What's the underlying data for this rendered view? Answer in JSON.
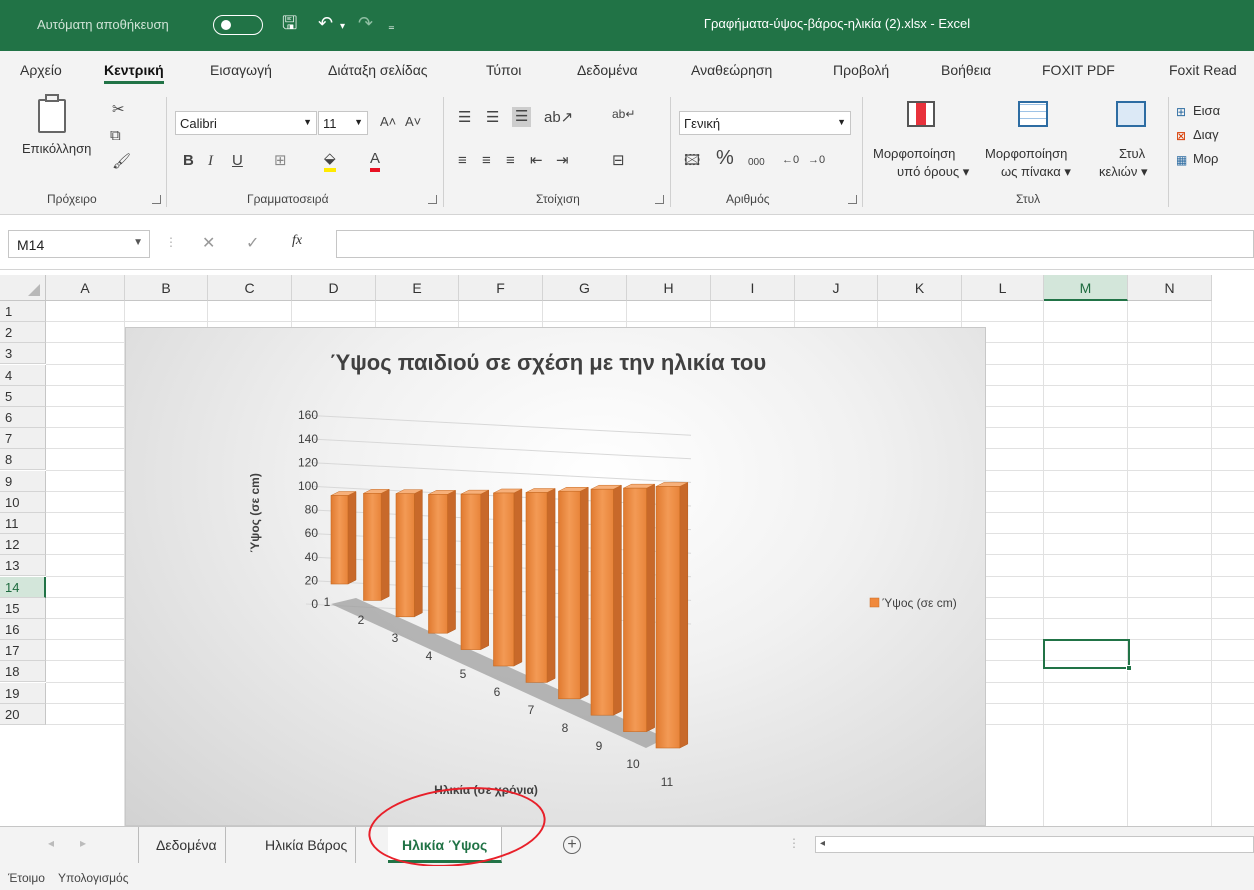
{
  "titlebar": {
    "autosave_label": "Αυτόματη αποθήκευση",
    "doc_title": "Γραφήματα-ύψος-βάρος-ηλικία (2).xlsx  -  Excel"
  },
  "ribbon_tabs": [
    "Αρχείο",
    "Κεντρική",
    "Εισαγωγή",
    "Διάταξη σελίδας",
    "Τύποι",
    "Δεδομένα",
    "Αναθεώρηση",
    "Προβολή",
    "Βοήθεια",
    "FOXIT PDF",
    "Foxit Read"
  ],
  "active_tab": "Κεντρική",
  "ribbon": {
    "paste_label": "Επικόλληση",
    "clipboard_label": "Πρόχειρο",
    "font_name": "Calibri",
    "font_size": "11",
    "font_label": "Γραμματοσειρά",
    "alignment_label": "Στοίχιση",
    "number_format": "Γενική",
    "number_label": "Αριθμός",
    "cond_format_1": "Μορφοποίηση",
    "cond_format_2": "υπό όρους ▾",
    "table_format_1": "Μορφοποίηση",
    "table_format_2": "ως πίνακα ▾",
    "cell_styles_1": "Στυλ",
    "cell_styles_2": "κελιών ▾",
    "styles_label": "Στυλ",
    "insert_label": "Εισα",
    "delete_label": "Διαγ",
    "format_label": "Μορ"
  },
  "formula_bar": {
    "name_box": "M14",
    "value": ""
  },
  "grid": {
    "columns": [
      "A",
      "B",
      "C",
      "D",
      "E",
      "F",
      "G",
      "H",
      "I",
      "J",
      "K",
      "L",
      "M",
      "N"
    ],
    "rows": [
      "1",
      "2",
      "3",
      "4",
      "5",
      "6",
      "7",
      "8",
      "9",
      "10",
      "11",
      "12",
      "13",
      "14",
      "15",
      "16",
      "17",
      "18",
      "19",
      "20"
    ],
    "selected_col": "M",
    "selected_row": "14"
  },
  "chart_data": {
    "type": "bar",
    "title": "Ύψος παιδιού σε σχέση με την ηλικία του",
    "xlabel": "Ηλικία (σε χρόνια)",
    "ylabel": "Ύψος (σε cm)",
    "categories": [
      "1",
      "2",
      "3",
      "4",
      "5",
      "6",
      "7",
      "8",
      "9",
      "10",
      "11"
    ],
    "series": [
      {
        "name": "Ύψος (σε cm)",
        "values": [
          75,
          86,
          94,
          101,
          108,
          115,
          121,
          127,
          133,
          138,
          143
        ]
      }
    ],
    "ylim": [
      0,
      160
    ],
    "yticks": [
      "0",
      "20",
      "40",
      "60",
      "80",
      "100",
      "120",
      "140",
      "160"
    ],
    "color": "#F0893C",
    "legend_position": "right",
    "style": "3d-column",
    "grid": true
  },
  "sheets": [
    "Δεδομένα",
    "Ηλικία Βάρος",
    "Ηλικία Ύψος"
  ],
  "active_sheet": "Ηλικία Ύψος",
  "status": {
    "ready": "Έτοιμο",
    "calc": "Υπολογισμός"
  }
}
